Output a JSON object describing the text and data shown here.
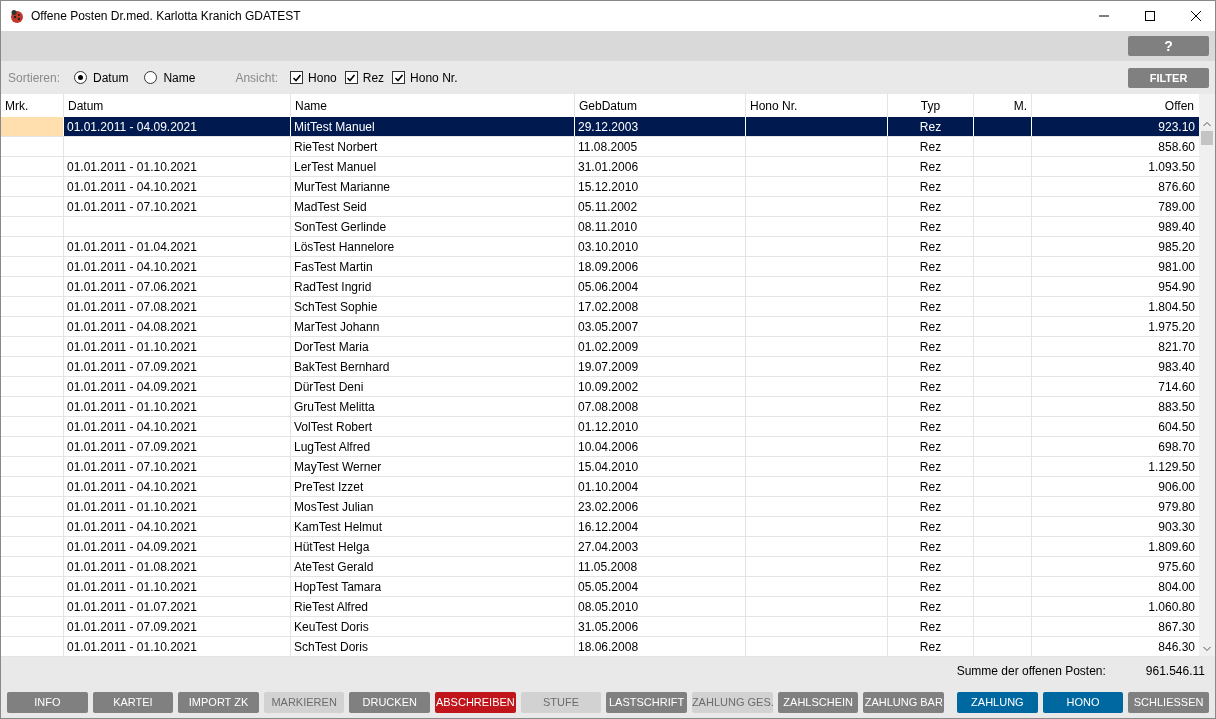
{
  "window": {
    "title": "Offene Posten Dr.med. Karlotta Kranich GDATEST"
  },
  "help_button": "?",
  "sort": {
    "label": "Sortieren:",
    "options": [
      {
        "label": "Datum",
        "selected": true
      },
      {
        "label": "Name",
        "selected": false
      }
    ]
  },
  "view": {
    "label": "Ansicht:",
    "options": [
      {
        "label": "Hono",
        "checked": true
      },
      {
        "label": "Rez",
        "checked": true
      },
      {
        "label": "Hono Nr.",
        "checked": true
      }
    ]
  },
  "filter_button": "FILTER",
  "table": {
    "columns": [
      "Mrk.",
      "Datum",
      "Name",
      "GebDatum",
      "Hono Nr.",
      "Typ",
      "M.",
      "Offen"
    ],
    "rows": [
      {
        "selected": true,
        "cells": [
          "",
          "01.01.2011 - 04.09.2021",
          "MitTest Manuel",
          "29.12.2003",
          "",
          "Rez",
          "",
          "923.10"
        ]
      },
      {
        "selected": false,
        "cells": [
          "",
          "",
          "RieTest Norbert",
          "11.08.2005",
          "",
          "Rez",
          "",
          "858.60"
        ]
      },
      {
        "selected": false,
        "cells": [
          "",
          "01.01.2011 - 01.10.2021",
          "LerTest Manuel",
          "31.01.2006",
          "",
          "Rez",
          "",
          "1.093.50"
        ]
      },
      {
        "selected": false,
        "cells": [
          "",
          "01.01.2011 - 04.10.2021",
          "MurTest Marianne",
          "15.12.2010",
          "",
          "Rez",
          "",
          "876.60"
        ]
      },
      {
        "selected": false,
        "cells": [
          "",
          "01.01.2011 - 07.10.2021",
          "MadTest Seid",
          "05.11.2002",
          "",
          "Rez",
          "",
          "789.00"
        ]
      },
      {
        "selected": false,
        "cells": [
          "",
          "",
          "SonTest Gerlinde",
          "08.11.2010",
          "",
          "Rez",
          "",
          "989.40"
        ]
      },
      {
        "selected": false,
        "cells": [
          "",
          "01.01.2011 - 01.04.2021",
          "LösTest Hannelore",
          "03.10.2010",
          "",
          "Rez",
          "",
          "985.20"
        ]
      },
      {
        "selected": false,
        "cells": [
          "",
          "01.01.2011 - 04.10.2021",
          "FasTest Martin",
          "18.09.2006",
          "",
          "Rez",
          "",
          "981.00"
        ]
      },
      {
        "selected": false,
        "cells": [
          "",
          "01.01.2011 - 07.06.2021",
          "RadTest Ingrid",
          "05.06.2004",
          "",
          "Rez",
          "",
          "954.90"
        ]
      },
      {
        "selected": false,
        "cells": [
          "",
          "01.01.2011 - 07.08.2021",
          "SchTest Sophie",
          "17.02.2008",
          "",
          "Rez",
          "",
          "1.804.50"
        ]
      },
      {
        "selected": false,
        "cells": [
          "",
          "01.01.2011 - 04.08.2021",
          "MarTest Johann",
          "03.05.2007",
          "",
          "Rez",
          "",
          "1.975.20"
        ]
      },
      {
        "selected": false,
        "cells": [
          "",
          "01.01.2011 - 01.10.2021",
          "DorTest Maria",
          "01.02.2009",
          "",
          "Rez",
          "",
          "821.70"
        ]
      },
      {
        "selected": false,
        "cells": [
          "",
          "01.01.2011 - 07.09.2021",
          "BakTest Bernhard",
          "19.07.2009",
          "",
          "Rez",
          "",
          "983.40"
        ]
      },
      {
        "selected": false,
        "cells": [
          "",
          "01.01.2011 - 04.09.2021",
          "DürTest Deni",
          "10.09.2002",
          "",
          "Rez",
          "",
          "714.60"
        ]
      },
      {
        "selected": false,
        "cells": [
          "",
          "01.01.2011 - 01.10.2021",
          "GruTest Melitta",
          "07.08.2008",
          "",
          "Rez",
          "",
          "883.50"
        ]
      },
      {
        "selected": false,
        "cells": [
          "",
          "01.01.2011 - 04.10.2021",
          "VolTest Robert",
          "01.12.2010",
          "",
          "Rez",
          "",
          "604.50"
        ]
      },
      {
        "selected": false,
        "cells": [
          "",
          "01.01.2011 - 07.09.2021",
          "LugTest Alfred",
          "10.04.2006",
          "",
          "Rez",
          "",
          "698.70"
        ]
      },
      {
        "selected": false,
        "cells": [
          "",
          "01.01.2011 - 07.10.2021",
          "MayTest Werner",
          "15.04.2010",
          "",
          "Rez",
          "",
          "1.129.50"
        ]
      },
      {
        "selected": false,
        "cells": [
          "",
          "01.01.2011 - 04.10.2021",
          "PreTest Izzet",
          "01.10.2004",
          "",
          "Rez",
          "",
          "906.00"
        ]
      },
      {
        "selected": false,
        "cells": [
          "",
          "01.01.2011 - 01.10.2021",
          "MosTest Julian",
          "23.02.2006",
          "",
          "Rez",
          "",
          "979.80"
        ]
      },
      {
        "selected": false,
        "cells": [
          "",
          "01.01.2011 - 04.10.2021",
          "KamTest Helmut",
          "16.12.2004",
          "",
          "Rez",
          "",
          "903.30"
        ]
      },
      {
        "selected": false,
        "cells": [
          "",
          "01.01.2011 - 04.09.2021",
          "HütTest Helga",
          "27.04.2003",
          "",
          "Rez",
          "",
          "1.809.60"
        ]
      },
      {
        "selected": false,
        "cells": [
          "",
          "01.01.2011 - 01.08.2021",
          "AteTest Gerald",
          "11.05.2008",
          "",
          "Rez",
          "",
          "975.60"
        ]
      },
      {
        "selected": false,
        "cells": [
          "",
          "01.01.2011 - 01.10.2021",
          "HopTest Tamara",
          "05.05.2004",
          "",
          "Rez",
          "",
          "804.00"
        ]
      },
      {
        "selected": false,
        "cells": [
          "",
          "01.01.2011 - 01.07.2021",
          "RieTest Alfred",
          "08.05.2010",
          "",
          "Rez",
          "",
          "1.060.80"
        ]
      },
      {
        "selected": false,
        "cells": [
          "",
          "01.01.2011 - 07.09.2021",
          "KeuTest Doris",
          "31.05.2006",
          "",
          "Rez",
          "",
          "867.30"
        ]
      },
      {
        "selected": false,
        "cells": [
          "",
          "01.01.2011 - 01.10.2021",
          "SchTest Doris",
          "18.06.2008",
          "",
          "Rez",
          "",
          "846.30"
        ]
      }
    ]
  },
  "total": {
    "label": "Summe der offenen Posten:",
    "value": "961.546.11"
  },
  "buttons": [
    {
      "label": "INFO",
      "kind": "normal"
    },
    {
      "label": "KARTEI",
      "kind": "normal"
    },
    {
      "label": "IMPORT ZK",
      "kind": "normal"
    },
    {
      "label": "MARKIEREN",
      "kind": "disabled"
    },
    {
      "label": "DRUCKEN",
      "kind": "normal"
    },
    {
      "label": "ABSCHREIBEN",
      "kind": "danger"
    },
    {
      "label": "STUFE",
      "kind": "disabled"
    },
    {
      "label": "LASTSCHRIFT",
      "kind": "normal"
    },
    {
      "label": "ZAHLUNG GES.",
      "kind": "disabled"
    },
    {
      "label": "ZAHLSCHEIN",
      "kind": "normal"
    },
    {
      "label": "ZAHLUNG BAR",
      "kind": "normal"
    },
    {
      "label": "ZAHLUNG",
      "kind": "primary"
    },
    {
      "label": "HONO",
      "kind": "primary"
    },
    {
      "label": "SCHLIESSEN",
      "kind": "normal"
    }
  ]
}
